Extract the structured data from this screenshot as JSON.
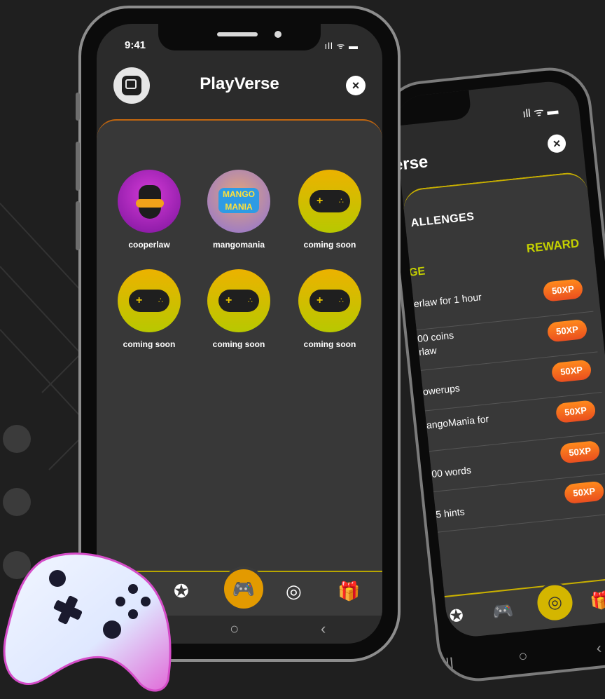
{
  "front": {
    "time": "9:41",
    "status_icons": "ıll ᯤ ▬",
    "title": "PlayVerse",
    "close_label": "×",
    "games": [
      {
        "label": "cooperlaw",
        "icon": "cooperlaw-avatar"
      },
      {
        "label": "mangomania",
        "icon": "mangomania-logo",
        "logo_text": "MANGO MANIA"
      },
      {
        "label": "coming soon",
        "icon": "gamepad-icon"
      },
      {
        "label": "coming soon",
        "icon": "gamepad-icon"
      },
      {
        "label": "coming soon",
        "icon": "gamepad-icon"
      },
      {
        "label": "coming soon",
        "icon": "gamepad-icon"
      }
    ],
    "nav": [
      "award-icon",
      "gamepad-icon",
      "target-icon",
      "gift-icon"
    ],
    "nav_active": "gamepad-icon"
  },
  "back": {
    "status_icons": "ıll ᯤ ▬",
    "title": "erse",
    "close_label": "×",
    "heading": "ALLENGES",
    "col_left": "GE",
    "col_right": "REWARD",
    "challenges": [
      {
        "text": "erlaw for 1 hour",
        "reward": "50XP"
      },
      {
        "text": "00 coins\nrlaw",
        "reward": "50XP"
      },
      {
        "text": "owerups",
        "reward": "50XP"
      },
      {
        "text": "angoMania for",
        "reward": "50XP"
      },
      {
        "text": "00 words",
        "reward": "50XP"
      },
      {
        "text": "5 hints",
        "reward": "50XP"
      }
    ],
    "nav_active": "target-icon"
  },
  "colors": {
    "background": "#1f1f1f",
    "accent_yellow": "#c4d000",
    "accent_orange": "#ea6a1f",
    "nav_active": "#e39a00"
  }
}
